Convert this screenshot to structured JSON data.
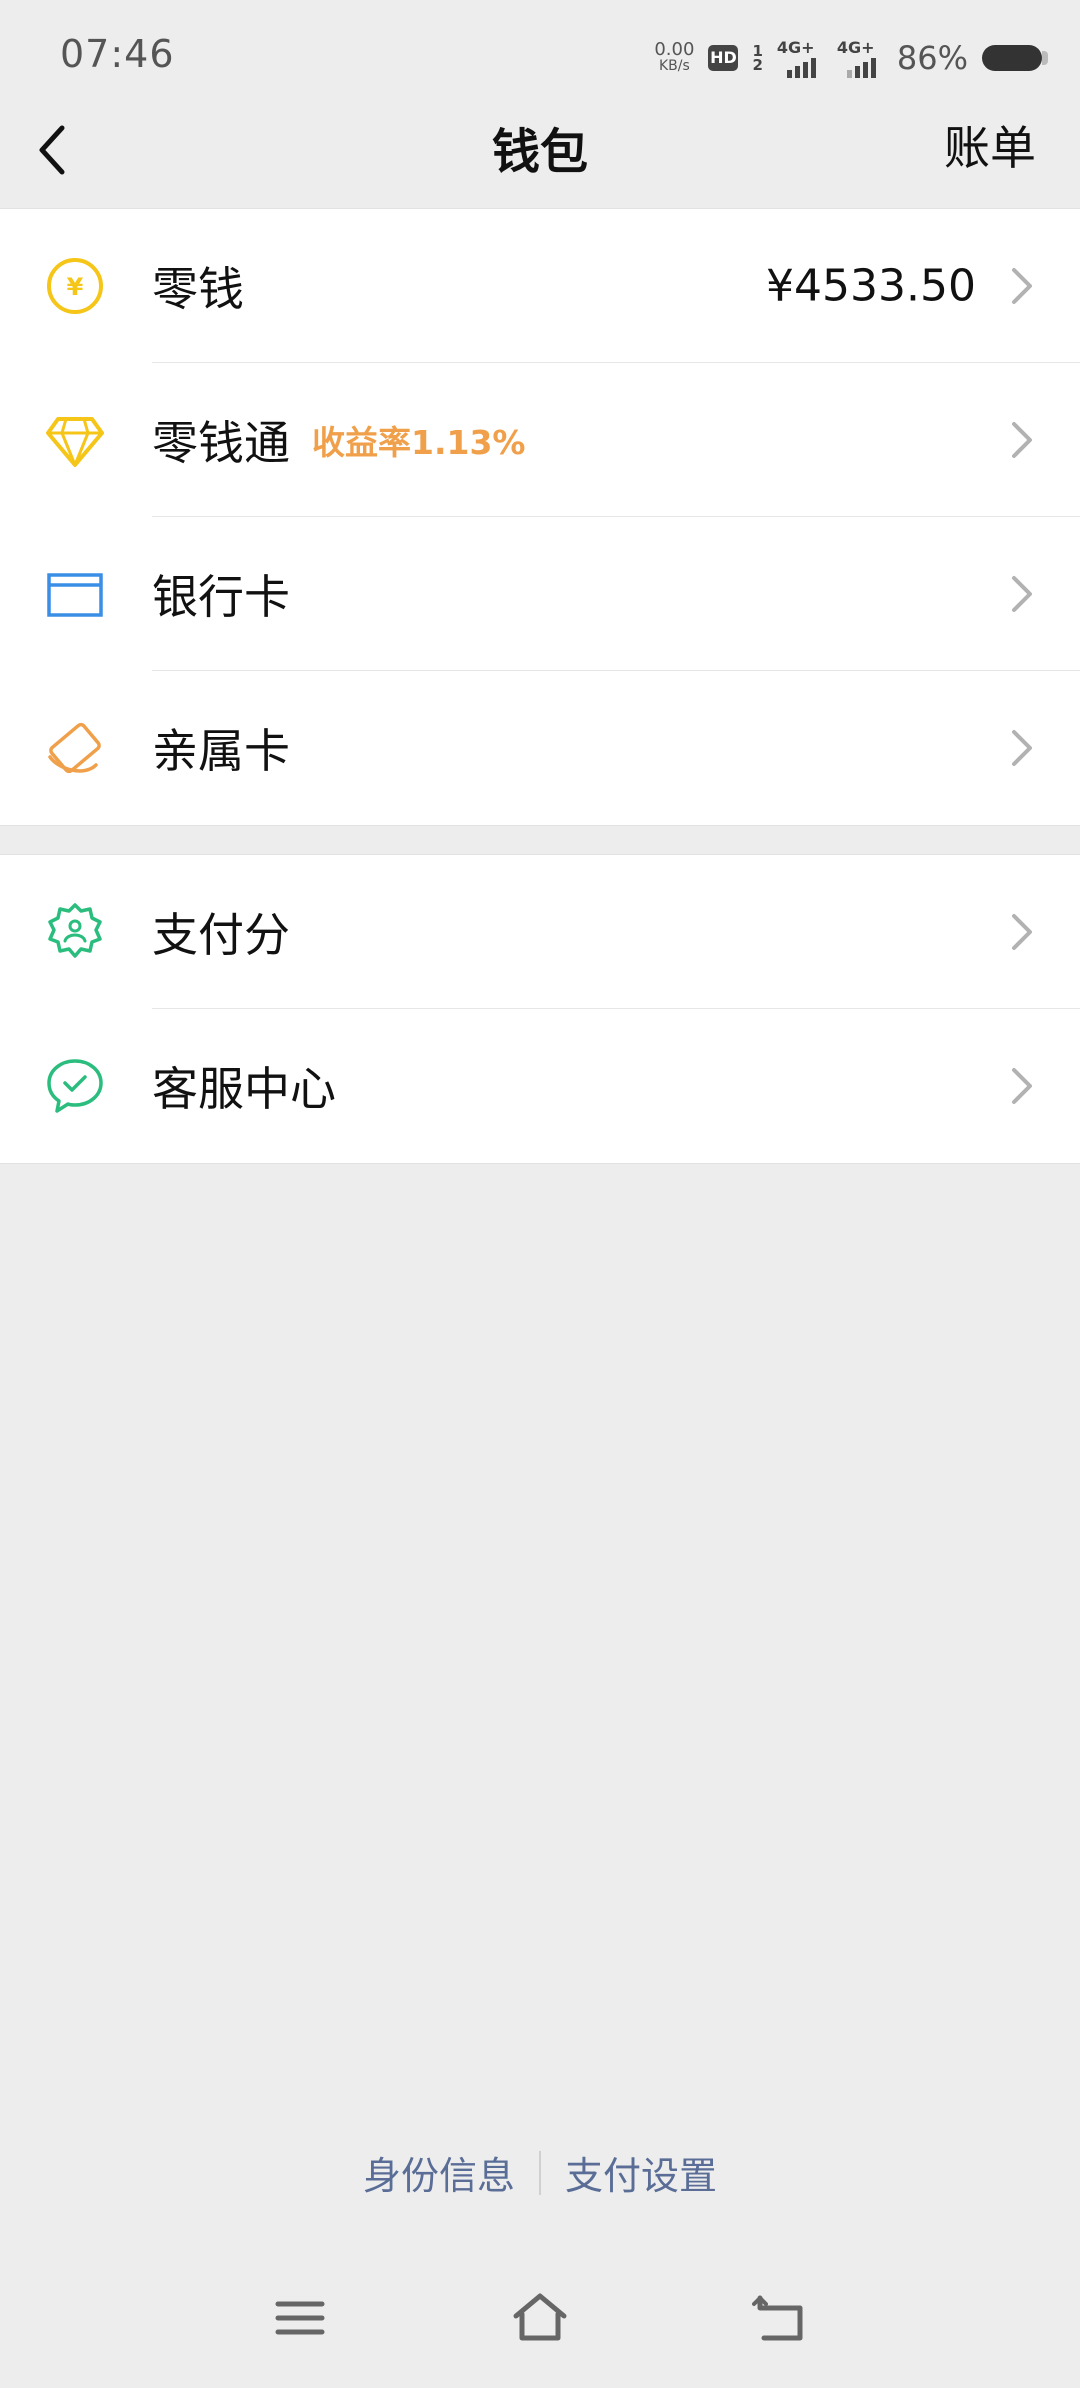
{
  "status_bar": {
    "time": "07:46",
    "net_speed": "0.00",
    "net_speed_unit": "KB/s",
    "hd": "HD",
    "sim_top": "1",
    "sim_bottom": "2",
    "network_1": "4G+",
    "network_2": "4G+",
    "battery": "86%"
  },
  "header": {
    "title": "钱包",
    "right_action": "账单",
    "back_icon": "back-arrow-icon"
  },
  "wallet_items": [
    {
      "label": "零钱",
      "value": "¥4533.50",
      "icon": "yuan-coin-icon",
      "color": "#f5c518"
    },
    {
      "label": "零钱通",
      "tag": "收益率1.13%",
      "icon": "diamond-icon",
      "color": "#f5c518"
    },
    {
      "label": "银行卡",
      "icon": "bank-card-icon",
      "color": "#3a8ee6"
    },
    {
      "label": "亲属卡",
      "icon": "family-card-icon",
      "color": "#f0a04a"
    }
  ],
  "service_items": [
    {
      "label": "支付分",
      "icon": "payment-score-icon",
      "color": "#2bbd7e"
    },
    {
      "label": "客服中心",
      "icon": "customer-service-icon",
      "color": "#2bbd7e"
    }
  ],
  "footer": {
    "identity": "身份信息",
    "payment_settings": "支付设置"
  },
  "colors": {
    "background": "#ededed",
    "link": "#5a6d96",
    "tag": "#f0a04a"
  }
}
